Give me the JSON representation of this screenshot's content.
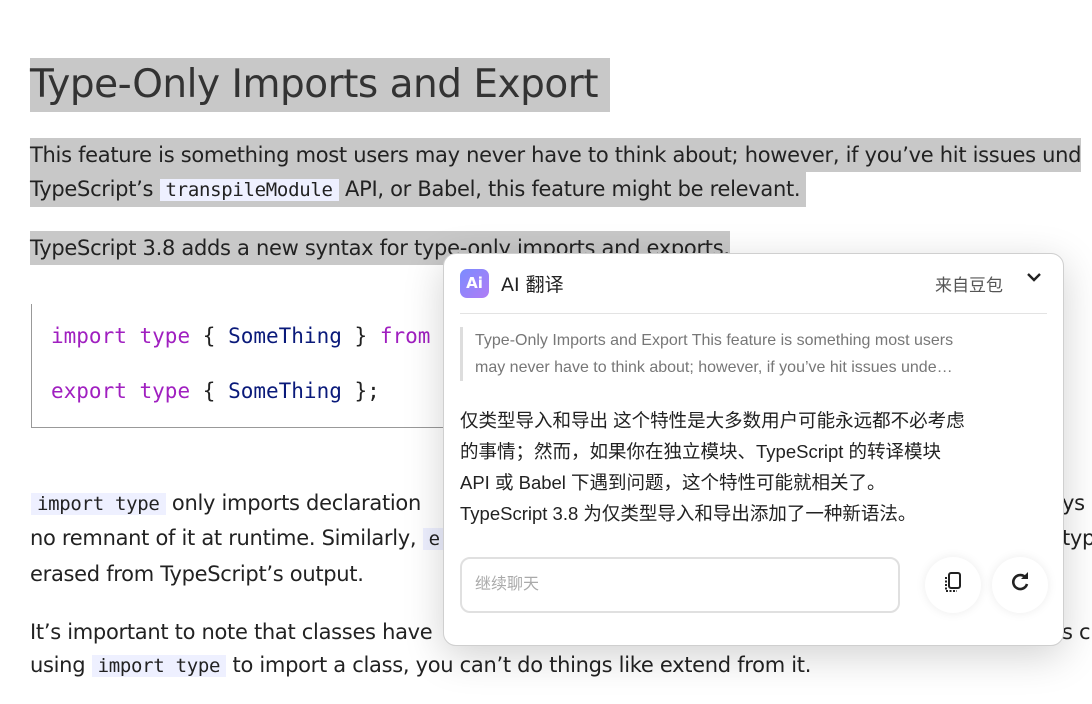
{
  "article": {
    "heading": "Type-Only Imports and Export",
    "p1_line1": "This feature is something most users may never have to think about; however, if you’ve hit issues und",
    "p1_line2_a": "TypeScript’s ",
    "p1_code": "transpileModule",
    "p1_line2_b": " API, or Babel, this feature might be relevant.",
    "p2": "TypeScript 3.8 adds a new syntax for type-only imports and exports.",
    "code_line1": {
      "kw1": "import",
      "kw2": "type",
      "open": "{",
      "id": "SomeThing",
      "close": "}",
      "kw3": "from",
      "str": "\""
    },
    "code_line2": {
      "kw1": "export",
      "kw2": "type",
      "open": "{",
      "id": "SomeThing",
      "close": "};"
    },
    "p3_code": "import type",
    "p3_line1": " only imports declaration",
    "p3_line1_right": "ys g",
    "p3_line2": "no remnant of it at runtime. Similarly, ",
    "p3_line2_code": "e",
    "p3_line2_right": "typ",
    "p3_line3": "erased from TypeScript’s output.",
    "p4_line1": "It’s important to note that classes have",
    "p4_line1_right": "s c",
    "p4_line2_a": "using ",
    "p4_code": "import type",
    "p4_line2_b": " to import a class, you can’t do things like extend from it."
  },
  "popup": {
    "logo_text": "Ai",
    "title": "AI 翻译",
    "source": "来自豆包",
    "chevron_icon": "chevron-down-icon",
    "original_line1": "Type-Only Imports and Export This feature is something most users",
    "original_line2": "may never have to think about; however, if you’ve hit issues unde…",
    "translation": [
      "仅类型导入和导出 这个特性是大多数用户可能永远都不必考虑",
      "的事情；然而，如果你在独立模块、TypeScript 的转译模块",
      "API 或 Babel 下遇到问题，这个特性可能就相关了。",
      "TypeScript 3.8 为仅类型导入和导出添加了一种新语法。"
    ],
    "chat_placeholder": "继续聊天",
    "copy_icon": "copy-icon",
    "refresh_icon": "refresh-icon",
    "accent": "#9a84f8"
  }
}
